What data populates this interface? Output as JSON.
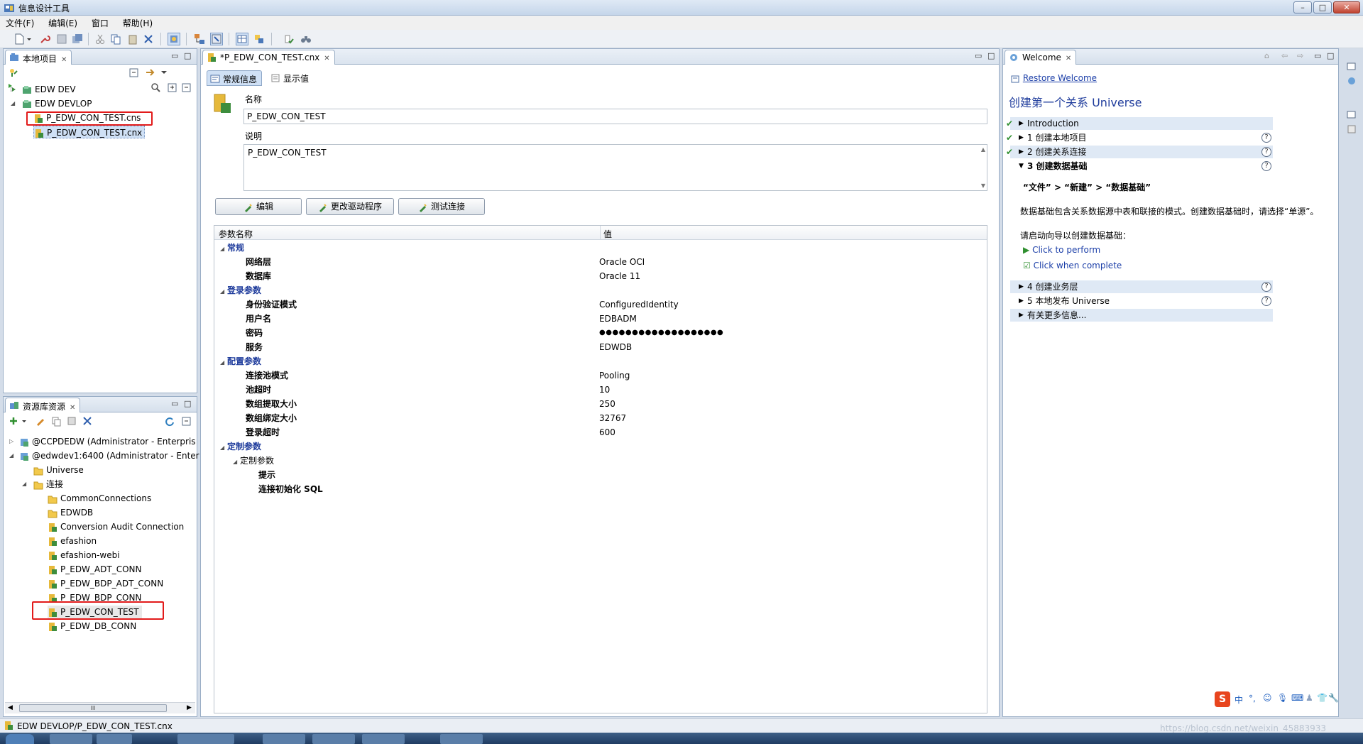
{
  "window": {
    "title": "信息设计工具",
    "min": "–",
    "max": "□",
    "close": "✕"
  },
  "menu": [
    "文件(F)",
    "编辑(E)",
    "窗口",
    "帮助(H)"
  ],
  "local_project": {
    "tab_label": "本地项目",
    "items": [
      {
        "label": "EDW DEV",
        "level": 0,
        "expanded": false
      },
      {
        "label": "EDW DEVLOP",
        "level": 0,
        "expanded": true
      },
      {
        "label": "P_EDW_CON_TEST.cns",
        "level": 1,
        "highlighted": true
      },
      {
        "label": "P_EDW_CON_TEST.cnx",
        "level": 1,
        "selected": true
      }
    ]
  },
  "repository": {
    "tab_label": "资源库资源",
    "items": [
      {
        "label": "@CCPDEDW (Administrator - Enterpris",
        "level": 0
      },
      {
        "label": "@edwdev1:6400 (Administrator - Enter",
        "level": 0
      },
      {
        "label": "Universe",
        "level": 1,
        "kind": "folder"
      },
      {
        "label": "连接",
        "level": 1,
        "kind": "folder"
      },
      {
        "label": "CommonConnections",
        "level": 2,
        "kind": "folder"
      },
      {
        "label": "EDWDB",
        "level": 2,
        "kind": "folder"
      },
      {
        "label": "Conversion Audit Connection",
        "level": 2,
        "kind": "conn"
      },
      {
        "label": "efashion",
        "level": 2,
        "kind": "conn"
      },
      {
        "label": "efashion-webi",
        "level": 2,
        "kind": "conn"
      },
      {
        "label": "P_EDW_ADT_CONN",
        "level": 2,
        "kind": "conn"
      },
      {
        "label": "P_EDW_BDP_ADT_CONN",
        "level": 2,
        "kind": "conn"
      },
      {
        "label": "P_EDW_BDP_CONN",
        "level": 2,
        "kind": "conn"
      },
      {
        "label": "P_EDW_CON_TEST",
        "level": 2,
        "kind": "conn",
        "highlighted": true
      },
      {
        "label": "P_EDW_DB_CONN",
        "level": 2,
        "kind": "conn"
      }
    ],
    "scroll_glyph": "III"
  },
  "editor": {
    "tab_label": "*P_EDW_CON_TEST.cnx",
    "subtabs": [
      "常规信息",
      "显示值"
    ],
    "name_label": "名称",
    "name_value": "P_EDW_CON_TEST",
    "desc_label": "说明",
    "desc_value": "P_EDW_CON_TEST",
    "buttons": [
      "编辑",
      "更改驱动程序",
      "测试连接"
    ],
    "table_headers": [
      "参数名称",
      "值"
    ],
    "rows": [
      {
        "type": "cat",
        "name": "常规"
      },
      {
        "type": "param",
        "name": "网络层",
        "value": "Oracle OCI"
      },
      {
        "type": "param",
        "name": "数据库",
        "value": "Oracle 11"
      },
      {
        "type": "cat",
        "name": "登录参数"
      },
      {
        "type": "param",
        "name": "身份验证模式",
        "value": "ConfiguredIdentity"
      },
      {
        "type": "param",
        "name": "用户名",
        "value": "EDBADM"
      },
      {
        "type": "param",
        "name": "密码",
        "value": "●●●●●●●●●●●●●●●●●●●"
      },
      {
        "type": "param",
        "name": "服务",
        "value": "EDWDB"
      },
      {
        "type": "cat",
        "name": "配置参数"
      },
      {
        "type": "param",
        "name": "连接池模式",
        "value": "Pooling"
      },
      {
        "type": "param",
        "name": "池超时",
        "value": "10"
      },
      {
        "type": "param",
        "name": "数组提取大小",
        "value": "250"
      },
      {
        "type": "param",
        "name": "数组绑定大小",
        "value": "32767"
      },
      {
        "type": "param",
        "name": "登录超时",
        "value": "600"
      },
      {
        "type": "cat",
        "name": "定制参数"
      },
      {
        "type": "subcat",
        "name": "定制参数"
      },
      {
        "type": "leaf",
        "name": "提示"
      },
      {
        "type": "leaf",
        "name": "连接初始化 SQL"
      }
    ]
  },
  "welcome": {
    "tab_label": "Welcome",
    "restore": "Restore Welcome",
    "heading": "创建第一个关系 Universe",
    "steps": [
      {
        "label": "Introduction",
        "done": true
      },
      {
        "label": "1 创建本地项目",
        "done": true,
        "help": true
      },
      {
        "label": "2 创建关系连接",
        "done": true,
        "help": true
      },
      {
        "label": "3 创建数据基础",
        "done": false,
        "help": true,
        "open": true
      }
    ],
    "step3": {
      "path": "“文件” > “新建” > “数据基础”",
      "desc": "数据基础包含关系数据源中表和联接的模式。创建数据基础时，请选择“单源”。",
      "prompt": "请启动向导以创建数据基础：",
      "perform": "Click to perform",
      "complete": "Click when complete"
    },
    "later_steps": [
      {
        "label": "4 创建业务层",
        "help": true
      },
      {
        "label": "5 本地发布 Universe",
        "help": true
      },
      {
        "label": "有关更多信息...",
        "help": false
      }
    ],
    "help_glyph": "?"
  },
  "status": {
    "path": "EDW DEVLOP/P_EDW_CON_TEST.cnx",
    "watermark": "https://blog.csdn.net/weixin_45883933"
  },
  "ime": {
    "logo": "S",
    "mode": "中"
  },
  "colors": {
    "accent": "#1f3c9c",
    "highlight_box": "#e21b1b",
    "selection": "#cfe0f5",
    "link": "#1c3fa8"
  }
}
